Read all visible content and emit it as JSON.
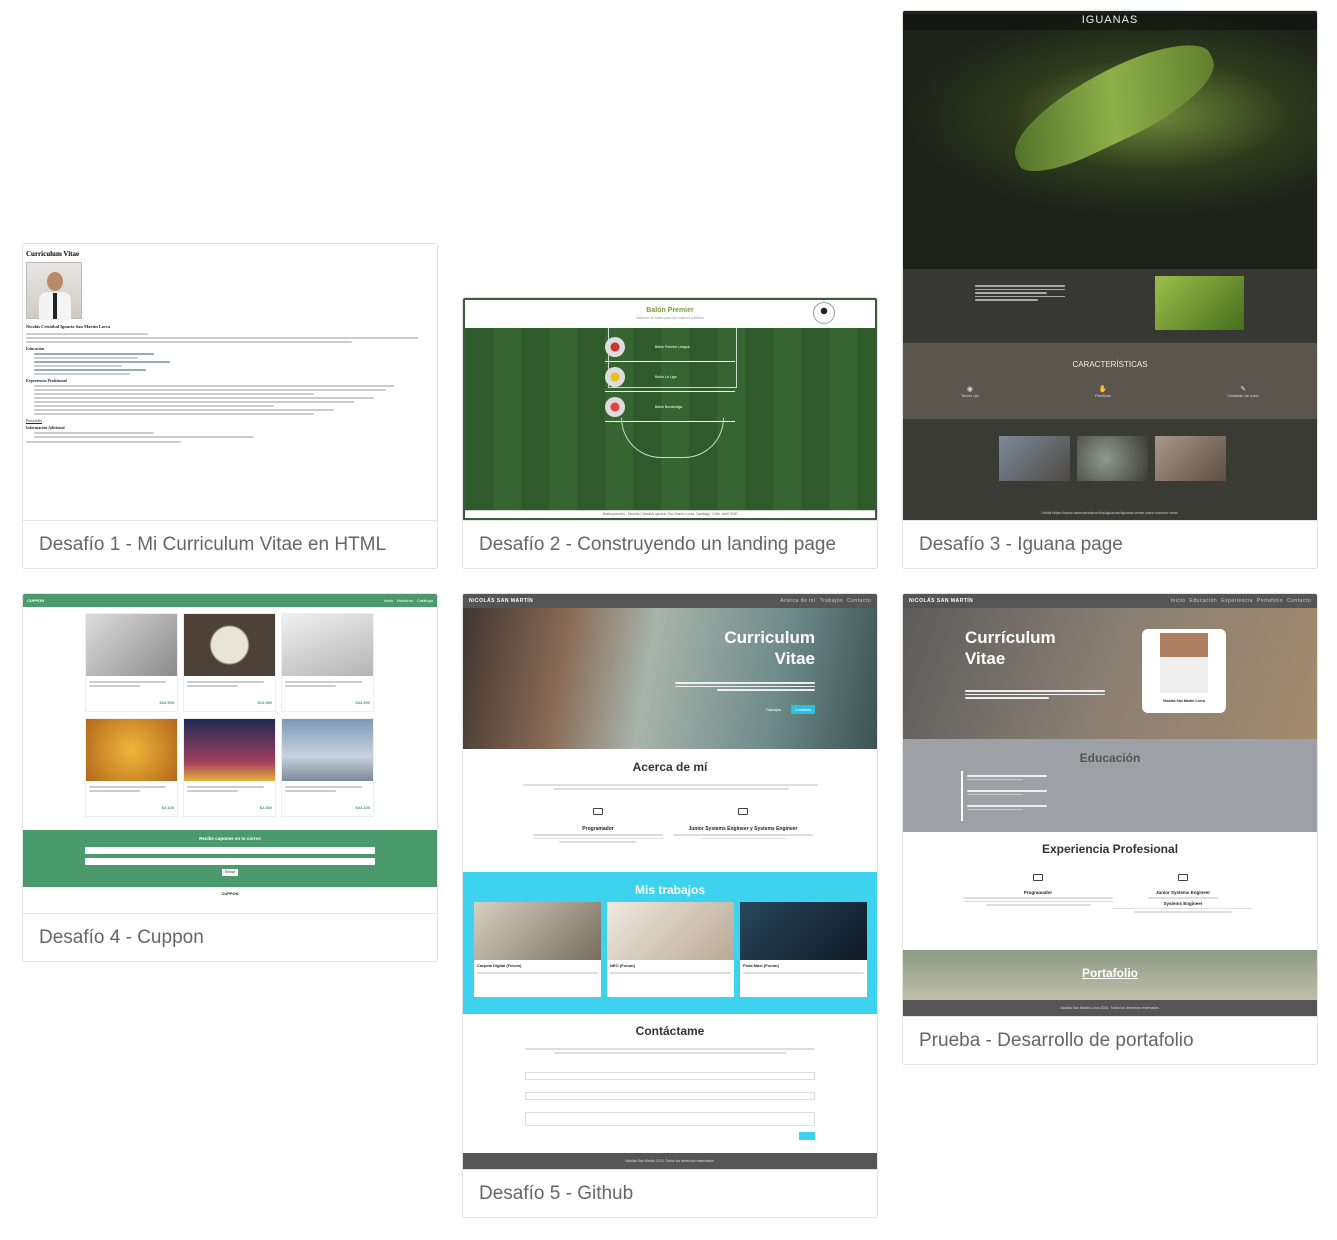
{
  "cards": [
    {
      "caption": "Desafío 1 - Mi Curriculum Vitae en HTML"
    },
    {
      "caption": "Desafío 2 - Construyendo un landing page"
    },
    {
      "caption": "Desafío 3 - Iguana page"
    },
    {
      "caption": "Desafío 4 - Cuppon"
    },
    {
      "caption": "Desafío 5 - Github"
    },
    {
      "caption": "Prueba - Desarrollo de portafolio"
    }
  ],
  "thumb1": {
    "title": "Curriculum Vitae",
    "name": "Nicolás Cristóbal Ignacio San Martín Lorca",
    "section1": "Educación",
    "section2": "Experiencia Profesional",
    "link": "Portafolio",
    "section3": "Información Adicional"
  },
  "thumb2": {
    "title": "Balón Premier",
    "subtitle": "Balones de fútbol para los mejores partidos",
    "items": [
      "Balón Premier League",
      "Balón La Liga",
      "Balón Bundesliga"
    ],
    "footer": "#balonpremier - Nicolás Cristóbal Ignacio San Martín Lorca, Santiago, Chile. Abril 2020"
  },
  "thumb3": {
    "title": "IGUANAS",
    "section": "CARACTERÍSTICAS",
    "features": [
      "Tercer ojo",
      "Pacíficas",
      "Cambian de color"
    ],
    "footer": "Visita https://www.animalesfavoritos/iguanas/iguana-verde para conocer más."
  },
  "thumb4": {
    "brand": "CUPPON",
    "nav": [
      "Inicio",
      "Nosotros",
      "Catálogo"
    ],
    "prices": [
      "$22.990",
      "$13.990",
      "$33.990",
      "$2.100",
      "$2.300",
      "$34.100"
    ],
    "newsletter": "Recibe cupones en tu correo",
    "button": "Enviar",
    "footer": "CUPPON"
  },
  "thumb5": {
    "brand": "NICOLÁS SAN MARTÍN",
    "nav": [
      "Acerca de mí",
      "Trabajos",
      "Contacto"
    ],
    "hero1": "Curriculum",
    "hero2": "Vitae",
    "about": "Acerca de mí",
    "role1": "Programador",
    "role2": "Junior Systems Engineer y Systems Engineer",
    "works": "Mis trabajos",
    "work_items": [
      "Carpeta Digital (Forum)",
      "NEO (Forum)",
      "Flota Maxi (Forum)"
    ],
    "contact": "Contáctame",
    "footer": "Nicolás San Martín 2023. Todos los derechos reservados."
  },
  "thumb6": {
    "brand": "NICOLÁS SAN MARTÍN",
    "nav": [
      "Inicio",
      "Educación",
      "Experiencia",
      "Portafolio",
      "Contacto"
    ],
    "hero1": "Currículum",
    "hero2": "Vitae",
    "photo_name": "Nicolás San Martín Lorca",
    "education": "Educación",
    "experience": "Experiencia Profesional",
    "role1": "Programador",
    "role2": "Junior Systems Engineer",
    "role3": "Systems Engineer",
    "portfolio": "Portafolio",
    "footer": "Nicolás San Martín Lorca 2024. Todos los derechos reservados."
  }
}
